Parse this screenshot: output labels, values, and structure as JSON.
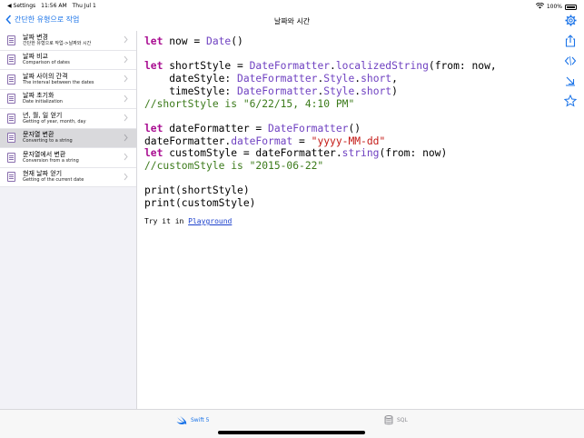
{
  "status": {
    "back_app": "◀ Settings",
    "time": "11:56 AM",
    "date": "Thu Jul 1",
    "battery": "100%"
  },
  "nav": {
    "back_label": "간단한 유형으로 작업",
    "title": "날짜와 시간"
  },
  "sidebar": {
    "items": [
      {
        "title": "날짜 변경",
        "subtitle": "간단한 유형으로 작업->날짜와 시간",
        "selected": false
      },
      {
        "title": "날짜 비교",
        "subtitle": "Comparison of dates",
        "selected": false
      },
      {
        "title": "날짜 사이의 간격",
        "subtitle": "The interval between the dates",
        "selected": false
      },
      {
        "title": "날짜 초기화",
        "subtitle": "Date initialization",
        "selected": false
      },
      {
        "title": "년, 월, 일 얻기",
        "subtitle": "Getting of year, month, day",
        "selected": false
      },
      {
        "title": "문자열 변환",
        "subtitle": "Converting to a string",
        "selected": true
      },
      {
        "title": "문자열에서 변환",
        "subtitle": "Conversion from a string",
        "selected": false
      },
      {
        "title": "현재 날짜 얻기",
        "subtitle": "Getting of the current date",
        "selected": false
      }
    ]
  },
  "code": {
    "lines": [
      "let now = Date()",
      "",
      "let shortStyle = DateFormatter.localizedString(from: now,",
      "    dateStyle: DateFormatter.Style.short,",
      "    timeStyle: DateFormatter.Style.short)",
      "//shortStyle is \"6/22/15, 4:10 PM\"",
      "",
      "let dateFormatter = DateFormatter()",
      "dateFormatter.dateFormat = \"yyyy-MM-dd\"",
      "let customStyle = dateFormatter.string(from: now)",
      "//customStyle is \"2015-06-22\"",
      "",
      "print(shortStyle)",
      "print(customStyle)"
    ],
    "try_prefix": "Try it in ",
    "try_link": "Playground"
  },
  "tools": [
    "share-icon",
    "code-icon",
    "download-icon",
    "star-icon"
  ],
  "tabs": [
    {
      "label": "Swift 5",
      "icon": "swift-icon",
      "active": true
    },
    {
      "label": "SQL",
      "icon": "database-icon",
      "active": false
    }
  ],
  "colors": {
    "accent": "#1a73e8",
    "keyword": "#a90d91",
    "type": "#6f41c1",
    "string": "#c41a16",
    "comment": "#3b7a1a",
    "selected_row": "#d9d9dc"
  }
}
